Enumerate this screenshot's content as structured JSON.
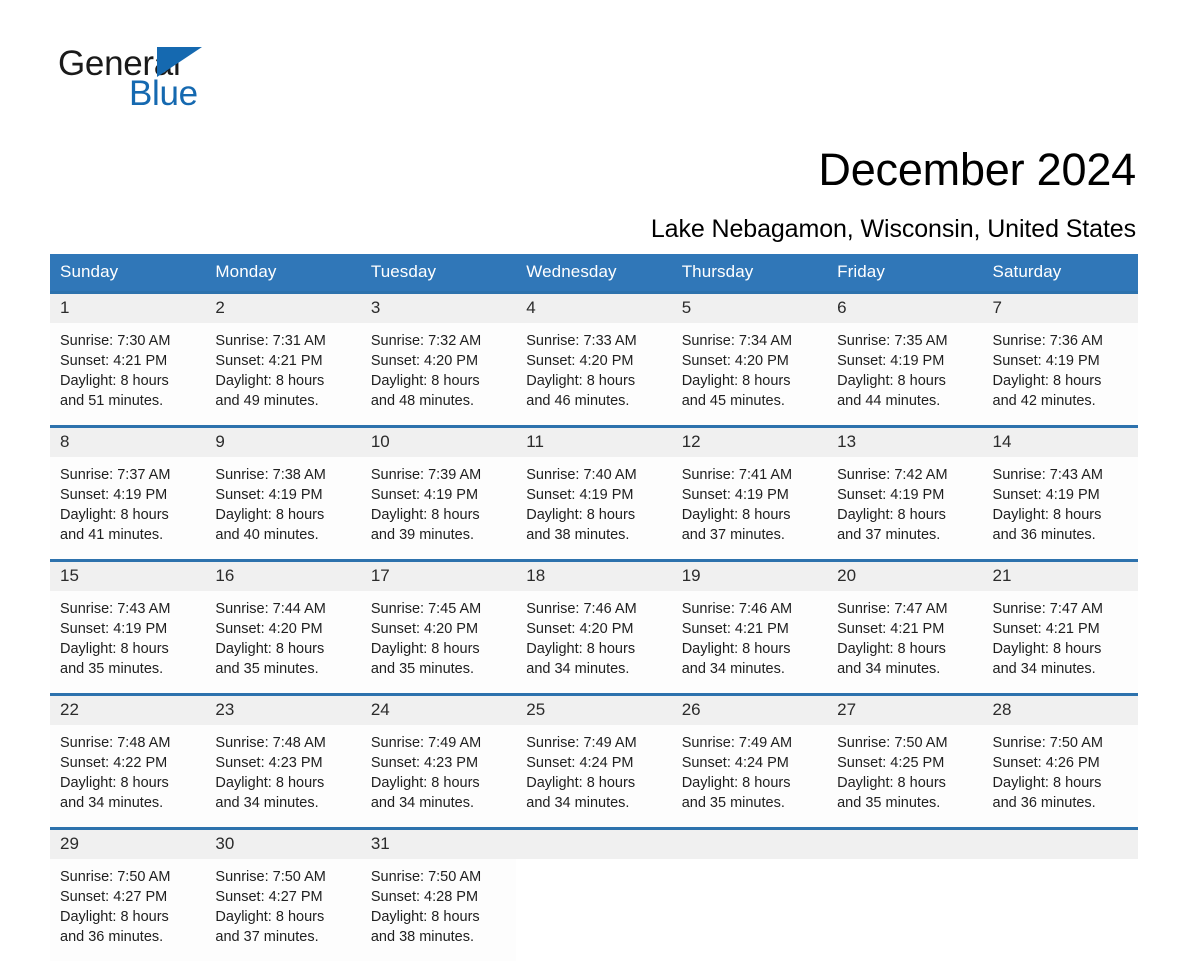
{
  "brand": {
    "word_one": "General",
    "word_two": "Blue",
    "triangle_color": "#1569b0"
  },
  "header": {
    "month_title": "December 2024",
    "location": "Lake Nebagamon, Wisconsin, United States",
    "header_bg": "#3077b8",
    "rule_color": "#2d72ad",
    "daynum_bg": "#f0f0f0"
  },
  "columns": [
    "Sunday",
    "Monday",
    "Tuesday",
    "Wednesday",
    "Thursday",
    "Friday",
    "Saturday"
  ],
  "weeks": [
    {
      "days": [
        {
          "date": "1",
          "sunrise": "Sunrise: 7:30 AM",
          "sunset": "Sunset: 4:21 PM",
          "daylight_1": "Daylight: 8 hours",
          "daylight_2": "and 51 minutes."
        },
        {
          "date": "2",
          "sunrise": "Sunrise: 7:31 AM",
          "sunset": "Sunset: 4:21 PM",
          "daylight_1": "Daylight: 8 hours",
          "daylight_2": "and 49 minutes."
        },
        {
          "date": "3",
          "sunrise": "Sunrise: 7:32 AM",
          "sunset": "Sunset: 4:20 PM",
          "daylight_1": "Daylight: 8 hours",
          "daylight_2": "and 48 minutes."
        },
        {
          "date": "4",
          "sunrise": "Sunrise: 7:33 AM",
          "sunset": "Sunset: 4:20 PM",
          "daylight_1": "Daylight: 8 hours",
          "daylight_2": "and 46 minutes."
        },
        {
          "date": "5",
          "sunrise": "Sunrise: 7:34 AM",
          "sunset": "Sunset: 4:20 PM",
          "daylight_1": "Daylight: 8 hours",
          "daylight_2": "and 45 minutes."
        },
        {
          "date": "6",
          "sunrise": "Sunrise: 7:35 AM",
          "sunset": "Sunset: 4:19 PM",
          "daylight_1": "Daylight: 8 hours",
          "daylight_2": "and 44 minutes."
        },
        {
          "date": "7",
          "sunrise": "Sunrise: 7:36 AM",
          "sunset": "Sunset: 4:19 PM",
          "daylight_1": "Daylight: 8 hours",
          "daylight_2": "and 42 minutes."
        }
      ]
    },
    {
      "days": [
        {
          "date": "8",
          "sunrise": "Sunrise: 7:37 AM",
          "sunset": "Sunset: 4:19 PM",
          "daylight_1": "Daylight: 8 hours",
          "daylight_2": "and 41 minutes."
        },
        {
          "date": "9",
          "sunrise": "Sunrise: 7:38 AM",
          "sunset": "Sunset: 4:19 PM",
          "daylight_1": "Daylight: 8 hours",
          "daylight_2": "and 40 minutes."
        },
        {
          "date": "10",
          "sunrise": "Sunrise: 7:39 AM",
          "sunset": "Sunset: 4:19 PM",
          "daylight_1": "Daylight: 8 hours",
          "daylight_2": "and 39 minutes."
        },
        {
          "date": "11",
          "sunrise": "Sunrise: 7:40 AM",
          "sunset": "Sunset: 4:19 PM",
          "daylight_1": "Daylight: 8 hours",
          "daylight_2": "and 38 minutes."
        },
        {
          "date": "12",
          "sunrise": "Sunrise: 7:41 AM",
          "sunset": "Sunset: 4:19 PM",
          "daylight_1": "Daylight: 8 hours",
          "daylight_2": "and 37 minutes."
        },
        {
          "date": "13",
          "sunrise": "Sunrise: 7:42 AM",
          "sunset": "Sunset: 4:19 PM",
          "daylight_1": "Daylight: 8 hours",
          "daylight_2": "and 37 minutes."
        },
        {
          "date": "14",
          "sunrise": "Sunrise: 7:43 AM",
          "sunset": "Sunset: 4:19 PM",
          "daylight_1": "Daylight: 8 hours",
          "daylight_2": "and 36 minutes."
        }
      ]
    },
    {
      "days": [
        {
          "date": "15",
          "sunrise": "Sunrise: 7:43 AM",
          "sunset": "Sunset: 4:19 PM",
          "daylight_1": "Daylight: 8 hours",
          "daylight_2": "and 35 minutes."
        },
        {
          "date": "16",
          "sunrise": "Sunrise: 7:44 AM",
          "sunset": "Sunset: 4:20 PM",
          "daylight_1": "Daylight: 8 hours",
          "daylight_2": "and 35 minutes."
        },
        {
          "date": "17",
          "sunrise": "Sunrise: 7:45 AM",
          "sunset": "Sunset: 4:20 PM",
          "daylight_1": "Daylight: 8 hours",
          "daylight_2": "and 35 minutes."
        },
        {
          "date": "18",
          "sunrise": "Sunrise: 7:46 AM",
          "sunset": "Sunset: 4:20 PM",
          "daylight_1": "Daylight: 8 hours",
          "daylight_2": "and 34 minutes."
        },
        {
          "date": "19",
          "sunrise": "Sunrise: 7:46 AM",
          "sunset": "Sunset: 4:21 PM",
          "daylight_1": "Daylight: 8 hours",
          "daylight_2": "and 34 minutes."
        },
        {
          "date": "20",
          "sunrise": "Sunrise: 7:47 AM",
          "sunset": "Sunset: 4:21 PM",
          "daylight_1": "Daylight: 8 hours",
          "daylight_2": "and 34 minutes."
        },
        {
          "date": "21",
          "sunrise": "Sunrise: 7:47 AM",
          "sunset": "Sunset: 4:21 PM",
          "daylight_1": "Daylight: 8 hours",
          "daylight_2": "and 34 minutes."
        }
      ]
    },
    {
      "days": [
        {
          "date": "22",
          "sunrise": "Sunrise: 7:48 AM",
          "sunset": "Sunset: 4:22 PM",
          "daylight_1": "Daylight: 8 hours",
          "daylight_2": "and 34 minutes."
        },
        {
          "date": "23",
          "sunrise": "Sunrise: 7:48 AM",
          "sunset": "Sunset: 4:23 PM",
          "daylight_1": "Daylight: 8 hours",
          "daylight_2": "and 34 minutes."
        },
        {
          "date": "24",
          "sunrise": "Sunrise: 7:49 AM",
          "sunset": "Sunset: 4:23 PM",
          "daylight_1": "Daylight: 8 hours",
          "daylight_2": "and 34 minutes."
        },
        {
          "date": "25",
          "sunrise": "Sunrise: 7:49 AM",
          "sunset": "Sunset: 4:24 PM",
          "daylight_1": "Daylight: 8 hours",
          "daylight_2": "and 34 minutes."
        },
        {
          "date": "26",
          "sunrise": "Sunrise: 7:49 AM",
          "sunset": "Sunset: 4:24 PM",
          "daylight_1": "Daylight: 8 hours",
          "daylight_2": "and 35 minutes."
        },
        {
          "date": "27",
          "sunrise": "Sunrise: 7:50 AM",
          "sunset": "Sunset: 4:25 PM",
          "daylight_1": "Daylight: 8 hours",
          "daylight_2": "and 35 minutes."
        },
        {
          "date": "28",
          "sunrise": "Sunrise: 7:50 AM",
          "sunset": "Sunset: 4:26 PM",
          "daylight_1": "Daylight: 8 hours",
          "daylight_2": "and 36 minutes."
        }
      ]
    },
    {
      "days": [
        {
          "date": "29",
          "sunrise": "Sunrise: 7:50 AM",
          "sunset": "Sunset: 4:27 PM",
          "daylight_1": "Daylight: 8 hours",
          "daylight_2": "and 36 minutes."
        },
        {
          "date": "30",
          "sunrise": "Sunrise: 7:50 AM",
          "sunset": "Sunset: 4:27 PM",
          "daylight_1": "Daylight: 8 hours",
          "daylight_2": "and 37 minutes."
        },
        {
          "date": "31",
          "sunrise": "Sunrise: 7:50 AM",
          "sunset": "Sunset: 4:28 PM",
          "daylight_1": "Daylight: 8 hours",
          "daylight_2": "and 38 minutes."
        },
        {
          "date": "",
          "sunrise": "",
          "sunset": "",
          "daylight_1": "",
          "daylight_2": ""
        },
        {
          "date": "",
          "sunrise": "",
          "sunset": "",
          "daylight_1": "",
          "daylight_2": ""
        },
        {
          "date": "",
          "sunrise": "",
          "sunset": "",
          "daylight_1": "",
          "daylight_2": ""
        },
        {
          "date": "",
          "sunrise": "",
          "sunset": "",
          "daylight_1": "",
          "daylight_2": ""
        }
      ]
    }
  ]
}
